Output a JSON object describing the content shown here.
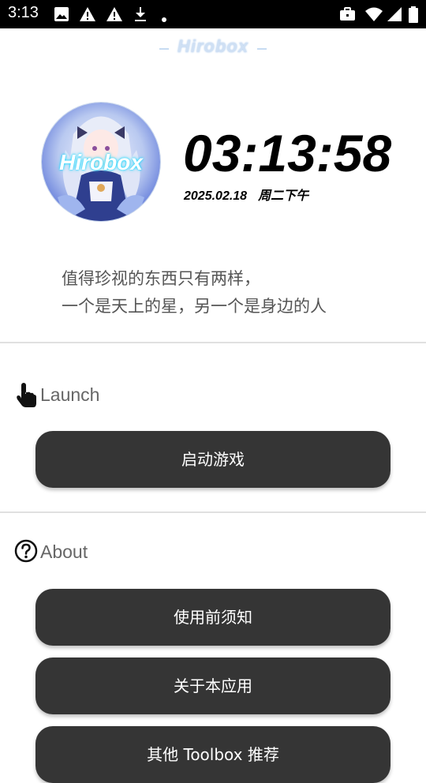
{
  "status_bar": {
    "time": "3:13",
    "icons": [
      "image-icon",
      "warning-icon",
      "warning-icon",
      "download-icon",
      "dot-icon",
      "briefcase-icon",
      "wifi-icon",
      "signal-icon",
      "battery-icon"
    ]
  },
  "header": {
    "logo_text": "Hirobox"
  },
  "avatar": {
    "logo_text": "Hirobox"
  },
  "clock": {
    "time": "03:13:58",
    "date": "2025.02.18",
    "weekday": "周二下午"
  },
  "quote": {
    "line1": "值得珍视的东西只有两样，",
    "line2": "一个是天上的星，另一个是身边的人"
  },
  "launch": {
    "label": "Launch",
    "icon": "touch-icon",
    "button": "启动游戏"
  },
  "about": {
    "label": "About",
    "icon": "help-circle-icon",
    "buttons": [
      "使用前须知",
      "关于本应用",
      "其他 Toolbox 推荐"
    ]
  },
  "colors": {
    "button_bg": "#353535",
    "button_text": "#ffffff",
    "section_text": "#666666",
    "quote_text": "#555555"
  }
}
